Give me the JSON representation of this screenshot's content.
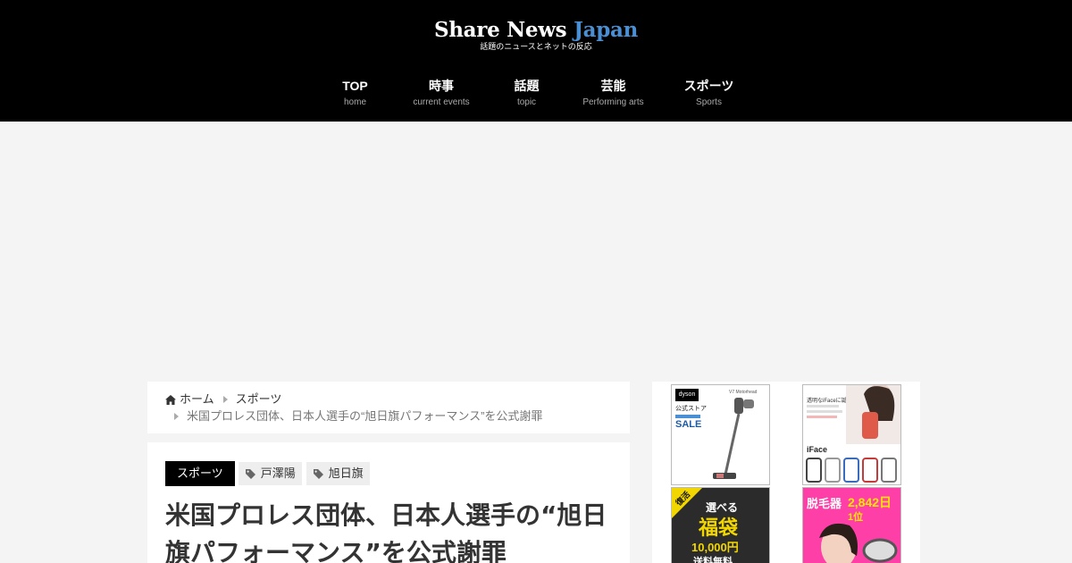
{
  "site": {
    "logo_main": "Share News",
    "logo_accent": "Japan",
    "logo_sub": "話題のニュースとネットの反応"
  },
  "nav": [
    {
      "label": "TOP",
      "sub": "home"
    },
    {
      "label": "時事",
      "sub": "current events"
    },
    {
      "label": "話題",
      "sub": "topic"
    },
    {
      "label": "芸能",
      "sub": "Performing arts"
    },
    {
      "label": "スポーツ",
      "sub": "Sports"
    }
  ],
  "breadcrumb": {
    "home": "ホーム",
    "category": "スポーツ",
    "current": "米国プロレス団体、日本人選手の“旭日旗パフォーマンス”を公式謝罪"
  },
  "article": {
    "category": "スポーツ",
    "tags": [
      "戸澤陽",
      "旭日旗"
    ],
    "title": "米国プロレス団体、日本人選手の“旭日旗パフォーマンス”を公式謝罪"
  },
  "sidebar_ads": [
    {
      "brand": "dyson",
      "line1": "公式ストア",
      "badge": "SALE",
      "model": "V7 Motorhead"
    },
    {
      "brand": "iFace",
      "line1": "透明なiFaceに誕生。"
    },
    {
      "line1": "選べる",
      "line2": "福袋",
      "line3": "10,000円",
      "line4": "送料無料",
      "corner": "復活"
    },
    {
      "line1": "脱毛器",
      "line2": "2,842日",
      "line3": "1位"
    }
  ],
  "colors": {
    "header_bg": "#000000",
    "accent": "#4a8fd4",
    "page_bg": "#f4f4f4"
  }
}
